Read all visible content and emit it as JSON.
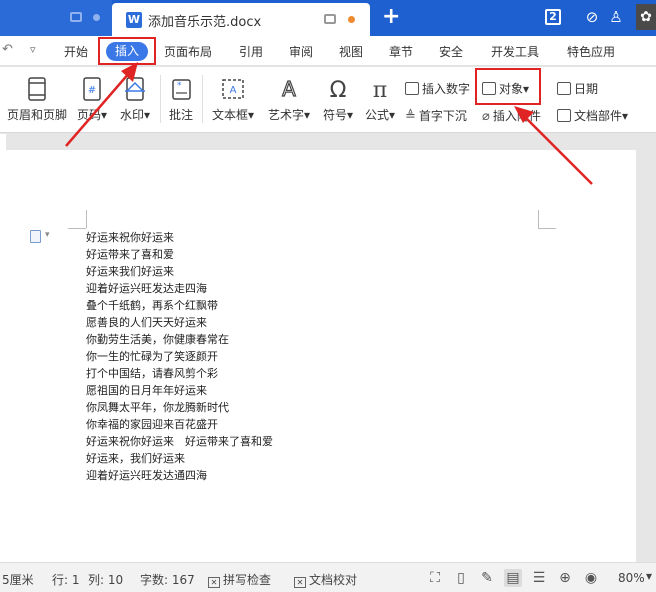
{
  "titlebar": {
    "doc_title": "添加音乐示范.docx",
    "doc_icon_letter": "W",
    "new_tab": "+",
    "window_count": "2"
  },
  "menubar": {
    "items": [
      {
        "label": "开始"
      },
      {
        "label": "插入"
      },
      {
        "label": "页面布局"
      },
      {
        "label": "引用"
      },
      {
        "label": "审阅"
      },
      {
        "label": "视图"
      },
      {
        "label": "章节"
      },
      {
        "label": "安全"
      },
      {
        "label": "开发工具"
      },
      {
        "label": "特色应用"
      }
    ]
  },
  "ribbon": {
    "header_footer": "页眉和页脚",
    "page_number": "页码▾",
    "watermark": "水印▾",
    "comment": "批注",
    "textbox": "文本框▾",
    "wordart": "艺术字▾",
    "symbol": "符号▾",
    "formula": "公式▾",
    "insert_number": "插入数字",
    "object": "对象▾",
    "date": "日期",
    "drop_cap": "首字下沉",
    "attachment": "插入附件",
    "doc_parts": "文档部件▾"
  },
  "document": {
    "lines": [
      "好运来祝你好运来",
      "好运带来了喜和爱",
      "好运来我们好运来",
      "迎着好运兴旺发达走四海",
      "叠个千纸鹤，再系个红飘带",
      "愿善良的人们天天好运来",
      "你勤劳生活美，你健康春常在",
      "你一生的忙碌为了笑逐颜开",
      "打个中国结，请春风剪个彩",
      "愿祖国的日月年年好运来",
      "你凤舞太平年，你龙腾新时代",
      "你幸福的家园迎来百花盛开",
      "好运来祝你好运来　好运带来了喜和爱",
      "好运来，我们好运来",
      "迎着好运兴旺发达通四海"
    ]
  },
  "statusbar": {
    "margin": "5厘米",
    "row": "行: 1",
    "col": "列: 10",
    "word_count": "字数: 167",
    "spellcheck": "拼写检查",
    "proofread": "文档校对",
    "zoom": "80%",
    "zoom_dd": "▾"
  },
  "colors": {
    "titlebar": "#1e60d0",
    "accent": "#3b78e7",
    "highlight_box": "#e02424"
  }
}
